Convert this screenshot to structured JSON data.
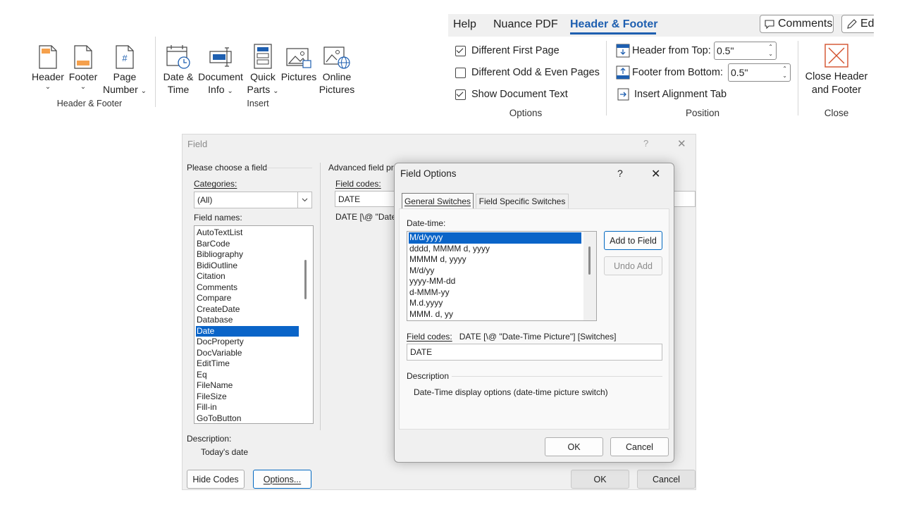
{
  "ribbon_left": {
    "groups": [
      {
        "label": "Header & Footer",
        "buttons": [
          {
            "line1": "Header",
            "line2": "",
            "chevron": "⌄"
          },
          {
            "line1": "Footer",
            "line2": "",
            "chevron": "⌄"
          },
          {
            "line1": "Page",
            "line2": "Number",
            "chevron": "⌄"
          }
        ]
      },
      {
        "label": "Insert",
        "buttons": [
          {
            "line1": "Date &",
            "line2": "Time"
          },
          {
            "line1": "Document",
            "line2": "Info",
            "chevron": "⌄"
          },
          {
            "line1": "Quick",
            "line2": "Parts",
            "chevron": "⌄"
          },
          {
            "line1": "Pictures",
            "line2": ""
          },
          {
            "line1": "Online",
            "line2": "Pictures"
          }
        ]
      }
    ]
  },
  "ribbon_right": {
    "tabs": [
      "Help",
      "Nuance PDF",
      "Header & Footer"
    ],
    "active_tab": "Header & Footer",
    "comments_button": "Comments",
    "edit_button": "Ed",
    "options": {
      "label": "Options",
      "items": [
        {
          "label": "Different First Page",
          "checked": true
        },
        {
          "label": "Different Odd & Even Pages",
          "checked": false
        },
        {
          "label": "Show Document Text",
          "checked": true
        }
      ]
    },
    "position": {
      "label": "Position",
      "header_from_top_label": "Header from Top:",
      "header_from_top_value": "0.5\"",
      "footer_from_bottom_label": "Footer from Bottom:",
      "footer_from_bottom_value": "0.5\"",
      "insert_alignment_tab": "Insert Alignment Tab"
    },
    "close": {
      "label": "Close",
      "button_line1": "Close Header",
      "button_line2": "and Footer"
    }
  },
  "field_dialog": {
    "title": "Field",
    "help": "?",
    "close": "✕",
    "choose_label": "Please choose a field",
    "categories_label": "Categories:",
    "categories_value": "(All)",
    "field_names_label": "Field names:",
    "field_names": [
      "AutoTextList",
      "BarCode",
      "Bibliography",
      "BidiOutline",
      "Citation",
      "Comments",
      "Compare",
      "CreateDate",
      "Database",
      "Date",
      "DocProperty",
      "DocVariable",
      "EditTime",
      "Eq",
      "FileName",
      "FileSize",
      "Fill-in",
      "GoToButton"
    ],
    "selected_field": "Date",
    "advanced_label": "Advanced field pro",
    "field_codes_label": "Field codes:",
    "field_codes_value": "DATE",
    "syntax_preview": "DATE [\\@ \"Date-",
    "description_label": "Description:",
    "description_value": "Today's date",
    "hide_codes_button": "Hide Codes",
    "options_button": "Options...",
    "ok_button": "OK",
    "cancel_button": "Cancel"
  },
  "field_options_dialog": {
    "title": "Field Options",
    "help": "?",
    "close": "✕",
    "tabs": [
      "General Switches",
      "Field Specific Switches"
    ],
    "active_tab": "General Switches",
    "datetime_label": "Date-time:",
    "formats": [
      "M/d/yyyy",
      "dddd, MMMM d, yyyy",
      "MMMM d, yyyy",
      "M/d/yy",
      "yyyy-MM-dd",
      "d-MMM-yy",
      "M.d.yyyy",
      "MMM. d, yy"
    ],
    "selected_format": "M/d/yyyy",
    "add_to_field_button": "Add to Field",
    "undo_add_button": "Undo Add",
    "field_codes_label": "Field codes:",
    "field_codes_syntax": "DATE [\\@ \"Date-Time Picture\"] [Switches]",
    "field_codes_value": "DATE",
    "description_label": "Description",
    "description_value": "Date-Time display options (date-time picture switch)",
    "ok_button": "OK",
    "cancel_button": "Cancel"
  }
}
